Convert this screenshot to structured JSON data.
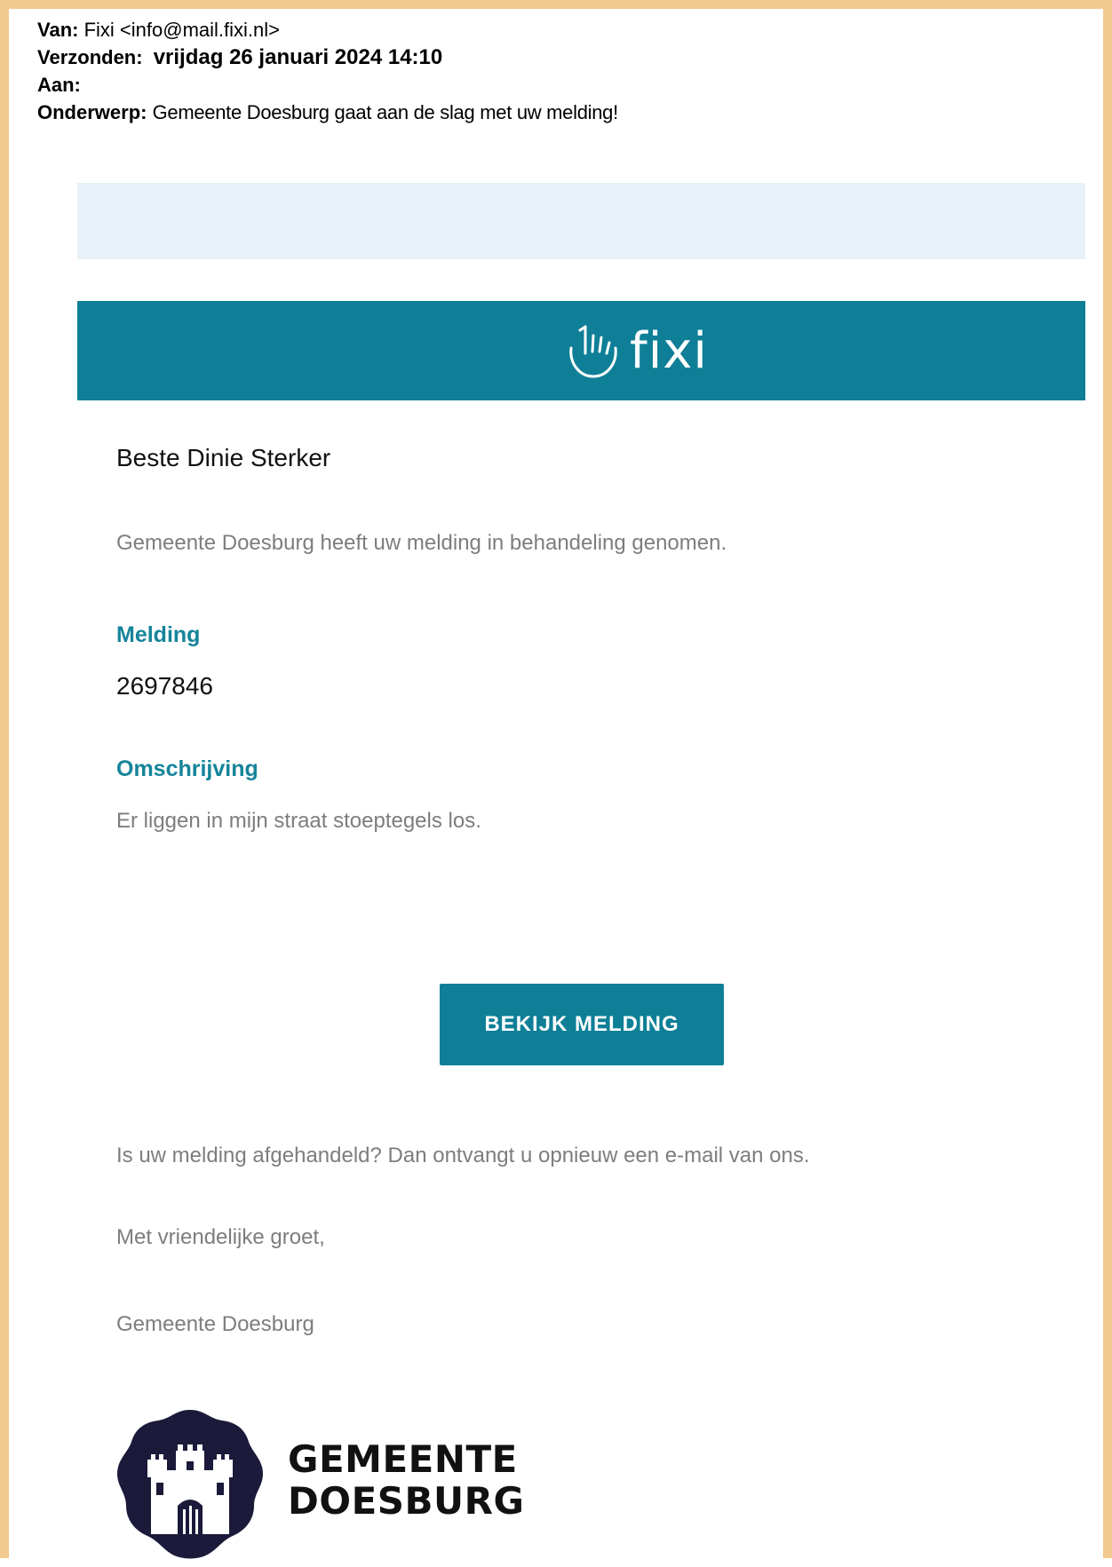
{
  "email": {
    "from_label": "Van:",
    "from_value": "Fixi <info@mail.fixi.nl>",
    "sent_label": "Verzonden:",
    "sent_value": "vrijdag 26 januari 2024 14:10",
    "to_label": "Aan:",
    "to_value": "",
    "subject_label": "Onderwerp:",
    "subject_value": "Gemeente Doesburg gaat aan de slag met uw melding!"
  },
  "banner": {
    "logo_text": "fixi",
    "logo_icon": "hand-icon",
    "bg_color": "#0e7f97"
  },
  "body": {
    "greeting": "Beste Dinie Sterker",
    "intro": "Gemeente Doesburg heeft uw melding in behandeling genomen.",
    "melding_label": "Melding",
    "melding_number": "2697846",
    "omschrijving_label": "Omschrijving",
    "omschrijving_text": "Er liggen in mijn straat stoeptegels los.",
    "button_label": "BEKIJK MELDING",
    "followup": "Is uw melding afgehandeld? Dan ontvangt u opnieuw een e-mail van ons.",
    "closing": "Met vriendelijke groet,",
    "signature": "Gemeente Doesburg"
  },
  "footer": {
    "brand_line1": "GEMEENTE",
    "brand_line2": "DOESBURG",
    "seal_icon": "castle-icon"
  },
  "colors": {
    "frame": "#f2c98f",
    "accent": "#0e7f97",
    "heading": "#15849a",
    "topband": "#e6f2f7",
    "muted_text": "#7d7d7d"
  }
}
